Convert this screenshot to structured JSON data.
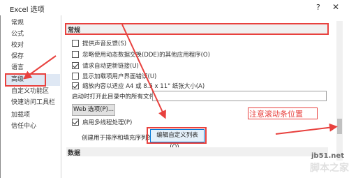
{
  "window": {
    "title": "Excel 选项",
    "help": "?",
    "close": "✕"
  },
  "sidebar": {
    "items": [
      {
        "label": "常规"
      },
      {
        "label": "公式"
      },
      {
        "label": "校对"
      },
      {
        "label": "保存"
      },
      {
        "label": "语言"
      },
      {
        "label": "高级",
        "selected": true
      },
      {
        "label": "自定义功能区"
      },
      {
        "label": "快速访问工具栏"
      },
      {
        "label": "加载项"
      },
      {
        "label": "信任中心"
      }
    ]
  },
  "section": {
    "title": "常规"
  },
  "options": [
    {
      "label": "提供声音反馈(S)",
      "checked": false
    },
    {
      "label": "忽略使用动态数据交换(DDE)的其他应用程序(O)",
      "checked": false
    },
    {
      "label": "请求自动更新链接(U)",
      "checked": true
    },
    {
      "label": "显示加载项用户界面错误(U)",
      "checked": false
    },
    {
      "label": "缩放内容以适应 A4 或 8.5 x 11\" 纸张大小(A)",
      "checked": true
    }
  ],
  "startup": {
    "label": "启动时打开此目录中的所有文件(L):",
    "value": ""
  },
  "web_options_label": "Web 选项(P)...",
  "multithread": {
    "label": "启用多线程处理(P)",
    "checked": true
  },
  "sort_list": {
    "label": "创建用于排序和填充序列的列表:",
    "button": "编辑自定义列表(O)..."
  },
  "data_section": {
    "title": "数据"
  },
  "annotation": {
    "text": "注意滚动条位置",
    "color": "#e8413e"
  },
  "watermark": {
    "line1": "jb51.net",
    "line2": "脚本之家"
  },
  "colors": {
    "accent": "#e8413e",
    "selected_bg": "#dfe8f4",
    "button_border": "#0078d7"
  }
}
